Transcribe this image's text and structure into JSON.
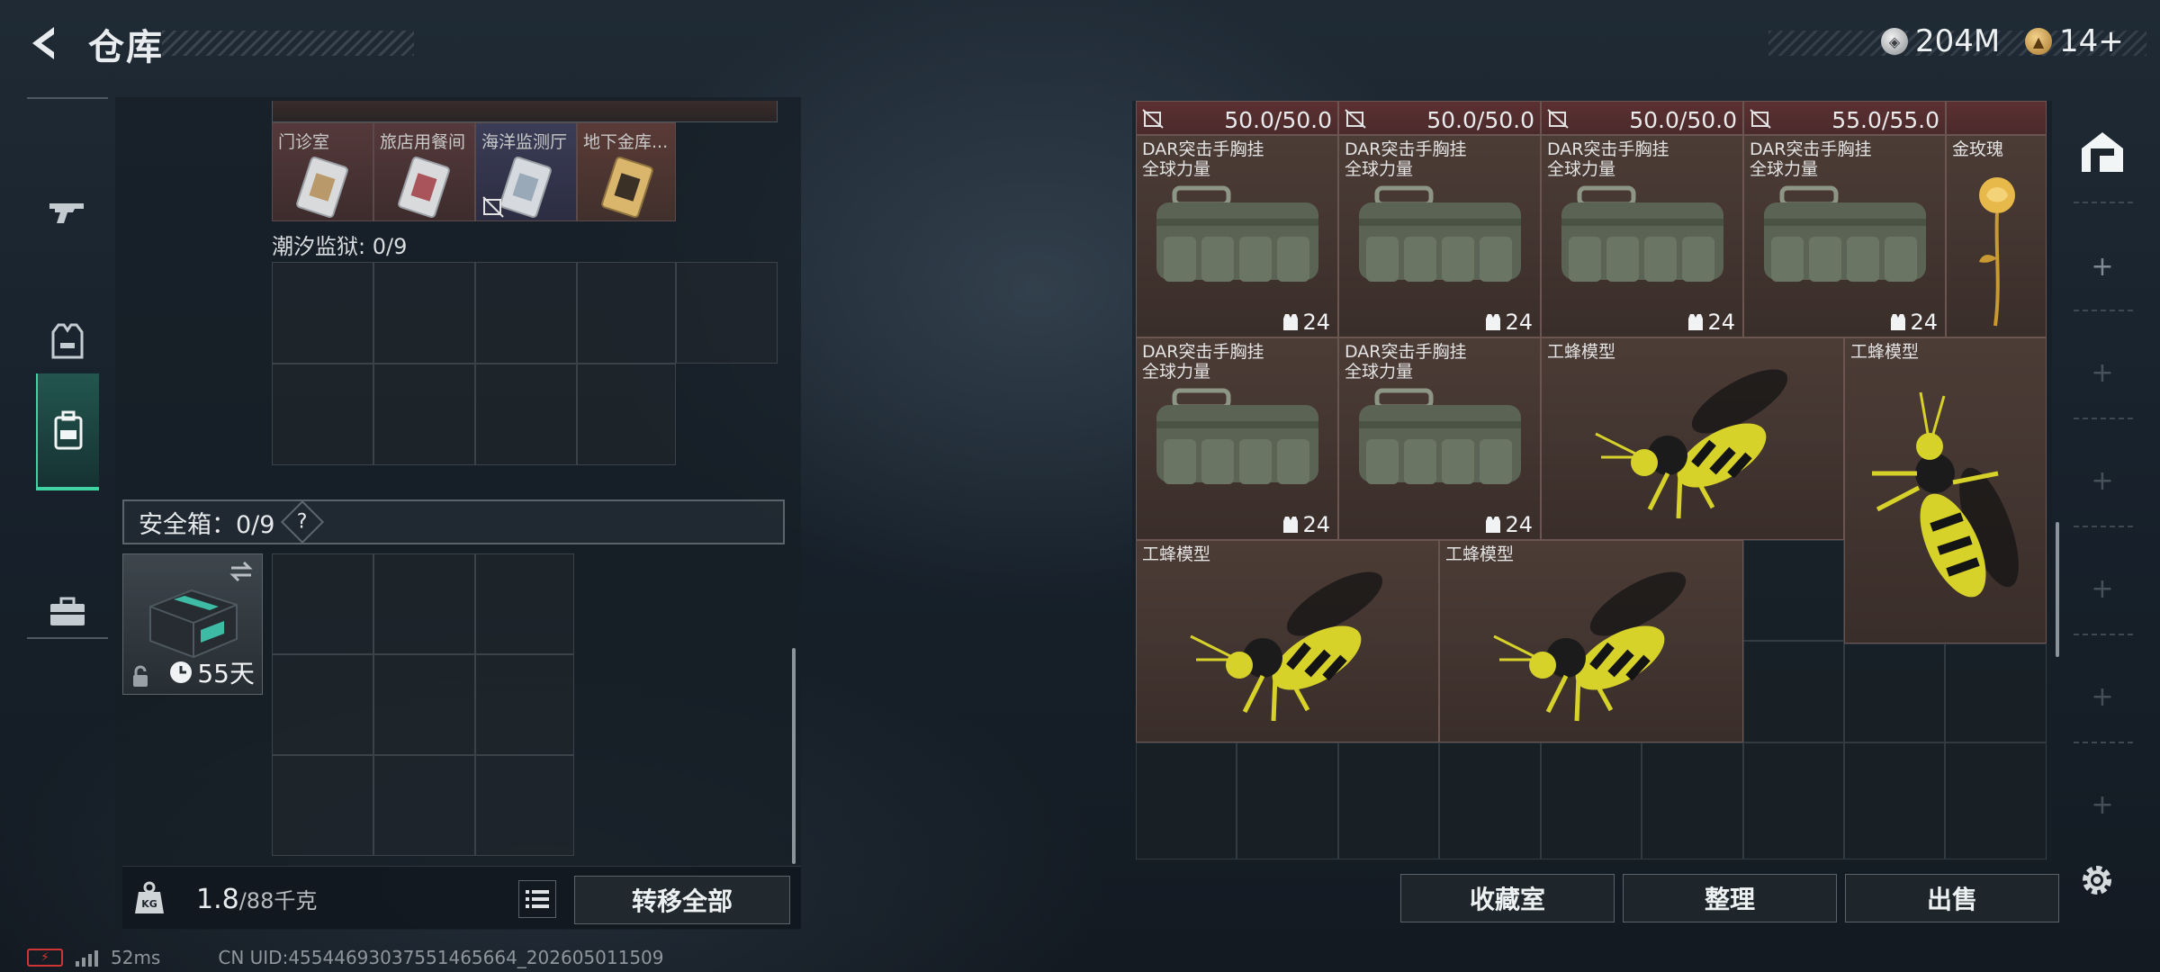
{
  "header": {
    "title": "仓库",
    "currency_silver": "204M",
    "currency_gold": "14+"
  },
  "left_rail": {
    "items": [
      {
        "name": "weapons",
        "icon": "gun-icon"
      },
      {
        "name": "armor",
        "icon": "armor-vest-icon"
      },
      {
        "name": "backpack",
        "icon": "backpack-icon",
        "active": true
      },
      {
        "name": "toolbox",
        "icon": "briefcase-icon"
      }
    ]
  },
  "key_cases": [
    {
      "name": "门诊室",
      "style": "silver"
    },
    {
      "name": "旅店用餐间",
      "style": "silver"
    },
    {
      "name": "海洋监测厅",
      "style": "silver-blue",
      "no_trade": true
    },
    {
      "name": "地下金库...",
      "style": "gold"
    }
  ],
  "prison": {
    "label": "潮汐监狱: 0/9"
  },
  "safebox": {
    "label": "安全箱：0/9",
    "help": "?",
    "days": "55天"
  },
  "weight": {
    "current": "1.8",
    "capacity": "/88千克",
    "icon_text": "KG"
  },
  "buttons": {
    "transfer_all": "转移全部",
    "collection_room": "收藏室",
    "sort": "整理",
    "sell": "出售"
  },
  "stash": {
    "durability_row": [
      "50.0/50.0",
      "50.0/50.0",
      "50.0/50.0",
      "55.0/55.0"
    ],
    "items": [
      {
        "name": "DAR突击手胸挂\n全球力量",
        "type": "rig",
        "count": "24"
      },
      {
        "name": "DAR突击手胸挂\n全球力量",
        "type": "rig",
        "count": "24"
      },
      {
        "name": "DAR突击手胸挂\n全球力量",
        "type": "rig",
        "count": "24"
      },
      {
        "name": "DAR突击手胸挂\n全球力量",
        "type": "rig",
        "count": "24"
      },
      {
        "name": "金玫瑰",
        "type": "rose",
        "count": ""
      },
      {
        "name": "DAR突击手胸挂\n全球力量",
        "type": "rig",
        "count": "24"
      },
      {
        "name": "DAR突击手胸挂\n全球力量",
        "type": "rig",
        "count": "24"
      },
      {
        "name": "工蜂模型",
        "type": "bee",
        "count": ""
      },
      {
        "name": "工蜂模型",
        "type": "bee-vertical",
        "count": ""
      },
      {
        "name": "工蜂模型",
        "type": "bee",
        "count": ""
      },
      {
        "name": "工蜂模型",
        "type": "bee",
        "count": ""
      }
    ]
  },
  "status": {
    "ping": "52ms",
    "uid": "CN UID:45544693037551465664_202605011509"
  },
  "colors": {
    "accent": "#3fd3a2",
    "item_bg": "#4c3c36",
    "key_bg": "#5a2e30",
    "battery_warn": "#d03535"
  }
}
